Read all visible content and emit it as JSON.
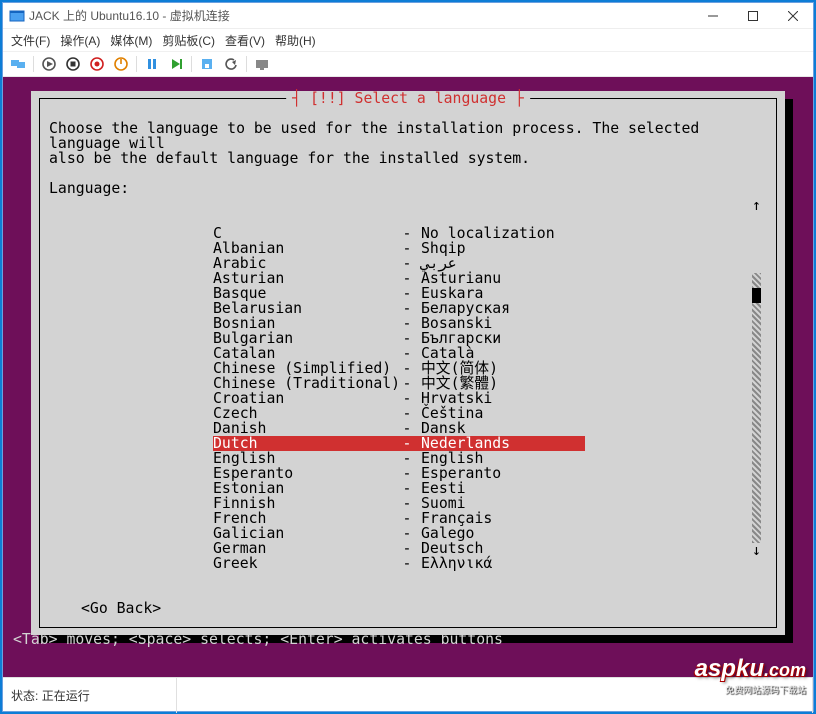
{
  "window": {
    "title": "JACK 上的 Ubuntu16.10 - 虚拟机连接"
  },
  "menu": {
    "file": "文件(F)",
    "action": "操作(A)",
    "media": "媒体(M)",
    "clipboard": "剪贴板(C)",
    "view": "查看(V)",
    "help": "帮助(H)"
  },
  "dialog": {
    "title": "[!!] Select a language",
    "prompt": "Choose the language to be used for the installation process. The selected language will\nalso be the default language for the installed system.",
    "label": "Language:",
    "go_back": "<Go Back>",
    "selected_index": 14,
    "languages": [
      {
        "name": "C",
        "native": "No localization"
      },
      {
        "name": "Albanian",
        "native": "Shqip"
      },
      {
        "name": "Arabic",
        "native": "عربي"
      },
      {
        "name": "Asturian",
        "native": "Asturianu"
      },
      {
        "name": "Basque",
        "native": "Euskara"
      },
      {
        "name": "Belarusian",
        "native": "Беларуская"
      },
      {
        "name": "Bosnian",
        "native": "Bosanski"
      },
      {
        "name": "Bulgarian",
        "native": "Български"
      },
      {
        "name": "Catalan",
        "native": "Català"
      },
      {
        "name": "Chinese (Simplified)",
        "native": "中文(简体)"
      },
      {
        "name": "Chinese (Traditional)",
        "native": "中文(繁體)"
      },
      {
        "name": "Croatian",
        "native": "Hrvatski"
      },
      {
        "name": "Czech",
        "native": "Čeština"
      },
      {
        "name": "Danish",
        "native": "Dansk"
      },
      {
        "name": "Dutch",
        "native": "Nederlands"
      },
      {
        "name": "English",
        "native": "English"
      },
      {
        "name": "Esperanto",
        "native": "Esperanto"
      },
      {
        "name": "Estonian",
        "native": "Eesti"
      },
      {
        "name": "Finnish",
        "native": "Suomi"
      },
      {
        "name": "French",
        "native": "Français"
      },
      {
        "name": "Galician",
        "native": "Galego"
      },
      {
        "name": "German",
        "native": "Deutsch"
      },
      {
        "name": "Greek",
        "native": "Ελληνικά"
      }
    ]
  },
  "hint": "<Tab> moves; <Space> selects; <Enter> activates buttons",
  "status": {
    "label": "状态:",
    "value": "正在运行"
  },
  "watermark": {
    "main": "aspku",
    "domain": ".com",
    "sub": "免费网站源码下载站"
  }
}
